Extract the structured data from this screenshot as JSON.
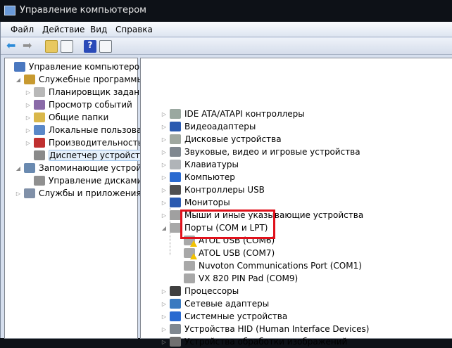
{
  "window": {
    "title": "Управление компьютером"
  },
  "menu": [
    "Файл",
    "Действие",
    "Вид",
    "Справка"
  ],
  "left_tree": [
    {
      "label": "Управление компьютером (л",
      "level": 0,
      "expander": "",
      "color": "#4a78c0"
    },
    {
      "label": "Служебные программы",
      "level": 1,
      "expander": "◢",
      "color": "#c89a30"
    },
    {
      "label": "Планировщик заданий",
      "level": 2,
      "expander": "▷",
      "color": "#b8b8b8"
    },
    {
      "label": "Просмотр событий",
      "level": 2,
      "expander": "▷",
      "color": "#8a6aa8"
    },
    {
      "label": "Общие папки",
      "level": 2,
      "expander": "▷",
      "color": "#d9b74a"
    },
    {
      "label": "Локальные пользовате",
      "level": 2,
      "expander": "▷",
      "color": "#5a88c8"
    },
    {
      "label": "Производительность",
      "level": 2,
      "expander": "▷",
      "color": "#c03030"
    },
    {
      "label": "Диспетчер устройств",
      "level": 2,
      "expander": "",
      "color": "#8a8a8a",
      "selected": true
    },
    {
      "label": "Запоминающие устройст",
      "level": 1,
      "expander": "◢",
      "color": "#6a8ab0"
    },
    {
      "label": "Управление дисками",
      "level": 2,
      "expander": "",
      "color": "#909090"
    },
    {
      "label": "Службы и приложения",
      "level": 1,
      "expander": "▷",
      "color": "#8090a8"
    }
  ],
  "device_tree": [
    {
      "label": "IDE ATA/ATAPI контроллеры",
      "level": 0,
      "expander": "▷",
      "color": "#9aa8a0"
    },
    {
      "label": "Видеоадаптеры",
      "level": 0,
      "expander": "▷",
      "color": "#2a5ab0"
    },
    {
      "label": "Дисковые устройства",
      "level": 0,
      "expander": "▷",
      "color": "#a0a8a0"
    },
    {
      "label": "Звуковые, видео и игровые устройства",
      "level": 0,
      "expander": "▷",
      "color": "#808890"
    },
    {
      "label": "Клавиатуры",
      "level": 0,
      "expander": "▷",
      "color": "#b0b4b8"
    },
    {
      "label": "Компьютер",
      "level": 0,
      "expander": "▷",
      "color": "#2a6ad0"
    },
    {
      "label": "Контроллеры USB",
      "level": 0,
      "expander": "▷",
      "color": "#505050"
    },
    {
      "label": "Мониторы",
      "level": 0,
      "expander": "▷",
      "color": "#2a5ab0"
    },
    {
      "label": "Мыши и иные указывающие устройства",
      "level": 0,
      "expander": "▷",
      "color": "#a0a0a0"
    },
    {
      "label": "Порты (COM и LPT)",
      "level": 0,
      "expander": "◢",
      "color": "#a8a8a8"
    },
    {
      "label": "ATOL USB (COM6)",
      "level": 1,
      "expander": "",
      "color": "#a8a8a8",
      "warning": true
    },
    {
      "label": "ATOL USB (COM7)",
      "level": 1,
      "expander": "",
      "color": "#a8a8a8",
      "warning": true
    },
    {
      "label": "Nuvoton Communications Port (COM1)",
      "level": 1,
      "expander": "",
      "color": "#a8a8a8"
    },
    {
      "label": "VX 820 PIN Pad (COM9)",
      "level": 1,
      "expander": "",
      "color": "#a8a8a8"
    },
    {
      "label": "Процессоры",
      "level": 0,
      "expander": "▷",
      "color": "#404040"
    },
    {
      "label": "Сетевые адаптеры",
      "level": 0,
      "expander": "▷",
      "color": "#3a7ac0"
    },
    {
      "label": "Системные устройства",
      "level": 0,
      "expander": "▷",
      "color": "#2a6ad0"
    },
    {
      "label": "Устройства HID (Human Interface Devices)",
      "level": 0,
      "expander": "▷",
      "color": "#808890"
    },
    {
      "label": "Устройства обработки изображений",
      "level": 0,
      "expander": "▷",
      "color": "#707070"
    }
  ],
  "colors": {
    "highlight_box": "#e0111b"
  }
}
